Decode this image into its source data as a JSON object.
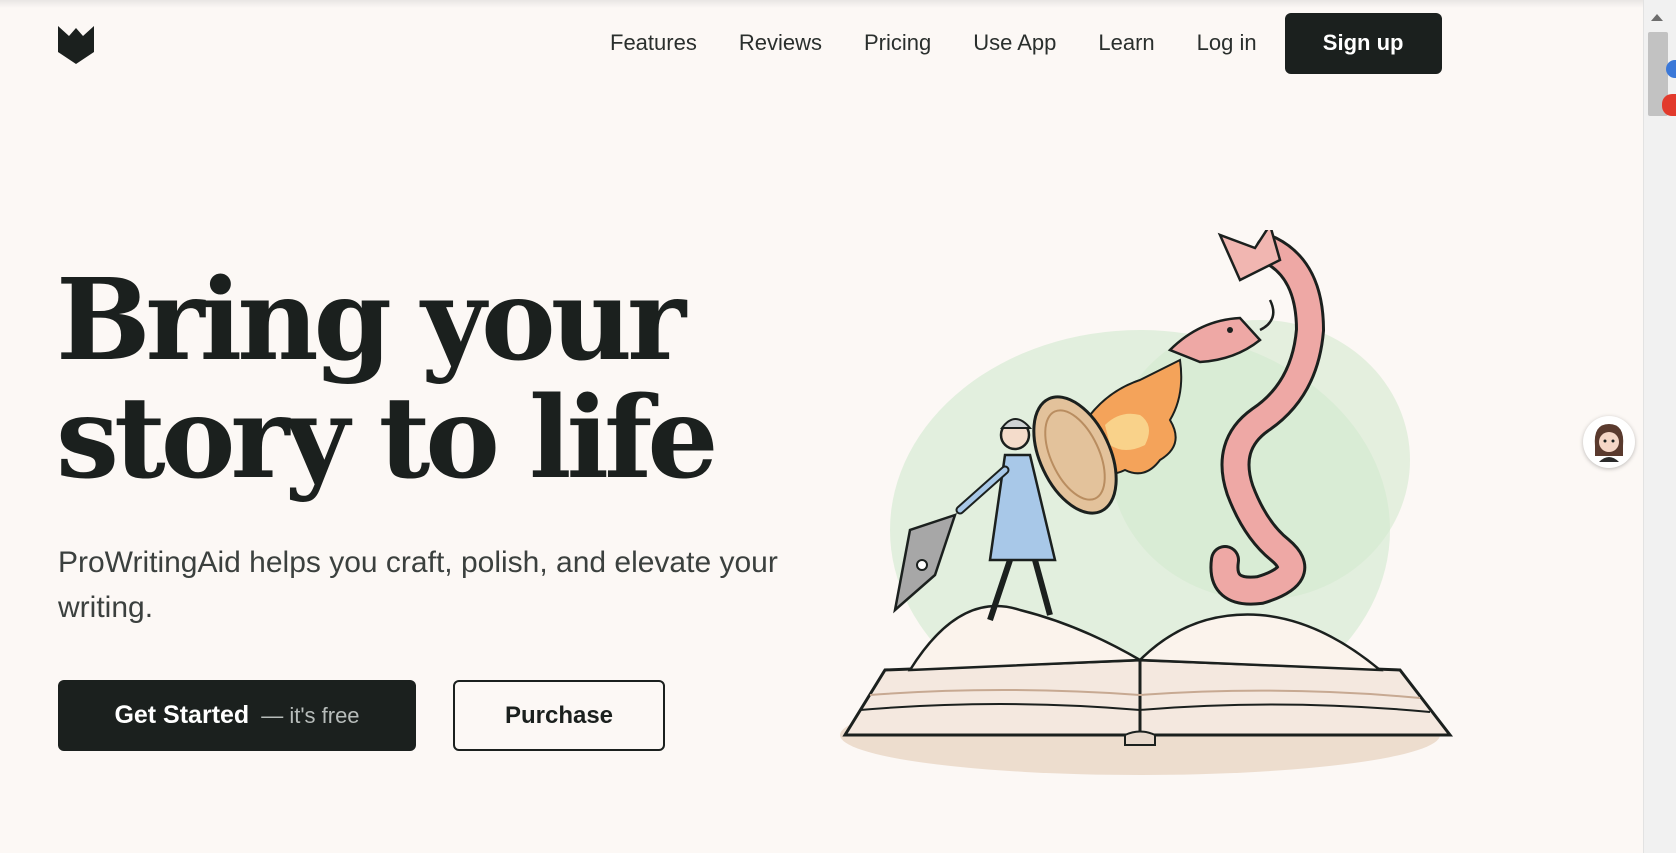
{
  "brand": {
    "logo_icon": "prowritingaid-logo-icon",
    "colors": {
      "background": "#fcf8f5",
      "primary": "#1b201e",
      "text": "#1d2220"
    }
  },
  "nav": {
    "items": [
      {
        "label": "Features"
      },
      {
        "label": "Reviews"
      },
      {
        "label": "Pricing"
      },
      {
        "label": "Use App"
      },
      {
        "label": "Learn"
      },
      {
        "label": "Log in"
      }
    ],
    "signup_label": "Sign up"
  },
  "hero": {
    "headline_line1": "Bring your",
    "headline_line2": "story to life",
    "subhead": "ProWritingAid helps you craft, polish, and elevate your writing.",
    "primary_cta": {
      "label": "Get Started",
      "suffix": "— it's free"
    },
    "secondary_cta": {
      "label": "Purchase"
    },
    "illustration": "knight-fighting-dragon-on-open-book-illustration"
  },
  "widgets": {
    "chat_avatar": "support-assistant-avatar-icon"
  }
}
